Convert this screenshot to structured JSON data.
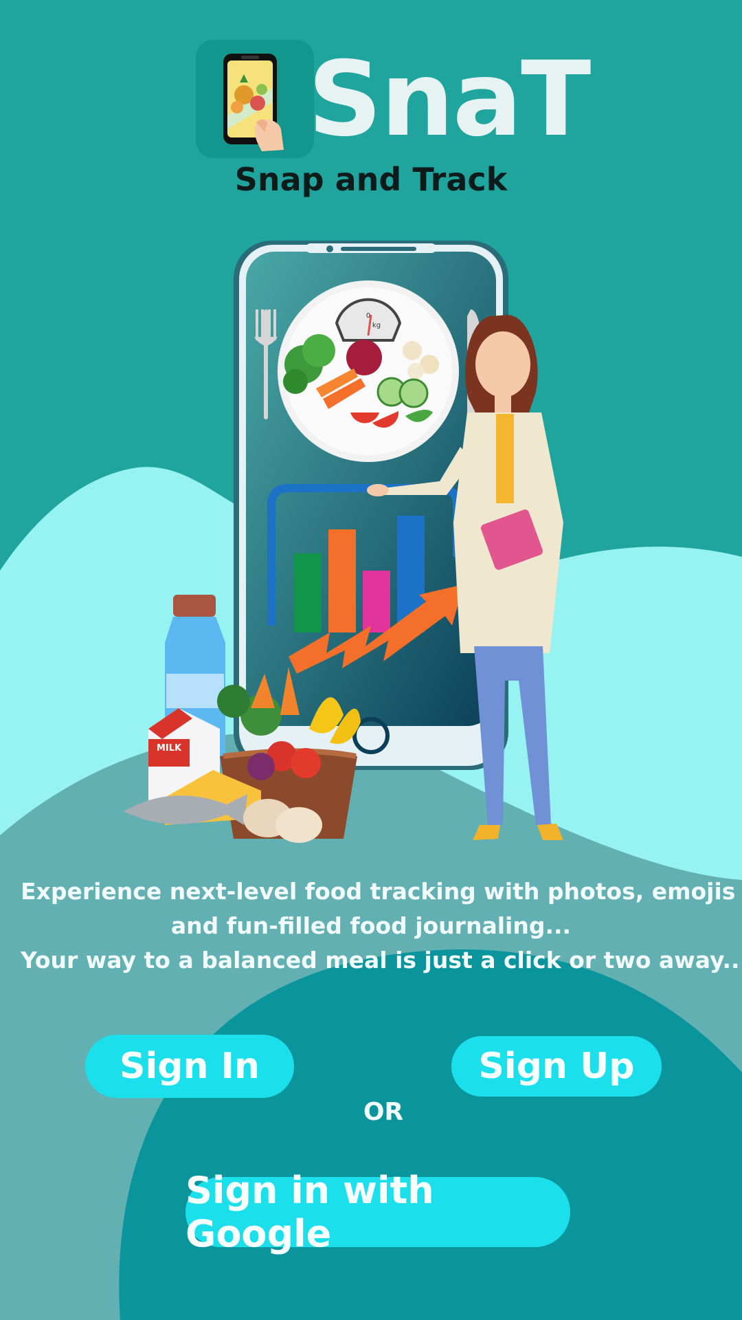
{
  "app": {
    "name": "SnaT",
    "tagline": "Snap and Track"
  },
  "hero": {
    "milk_label": "MILK",
    "scale_zero": "0",
    "scale_unit": "kg"
  },
  "intro": {
    "line1": "Experience next-level food tracking with photos, emojis",
    "line2": "and fun-filled food journaling...",
    "line3": "Your way to a balanced meal is just a click or two away..."
  },
  "auth": {
    "sign_in_label": "Sign In",
    "sign_up_label": "Sign Up",
    "or_label": "OR",
    "google_label": "Sign in with Google"
  },
  "colors": {
    "background_top": "#1fa59e",
    "background_light_wave": "#97f2f2",
    "background_mid": "#62b0b2",
    "background_dark_wave": "#0a959d",
    "button": "#1be0ec"
  }
}
